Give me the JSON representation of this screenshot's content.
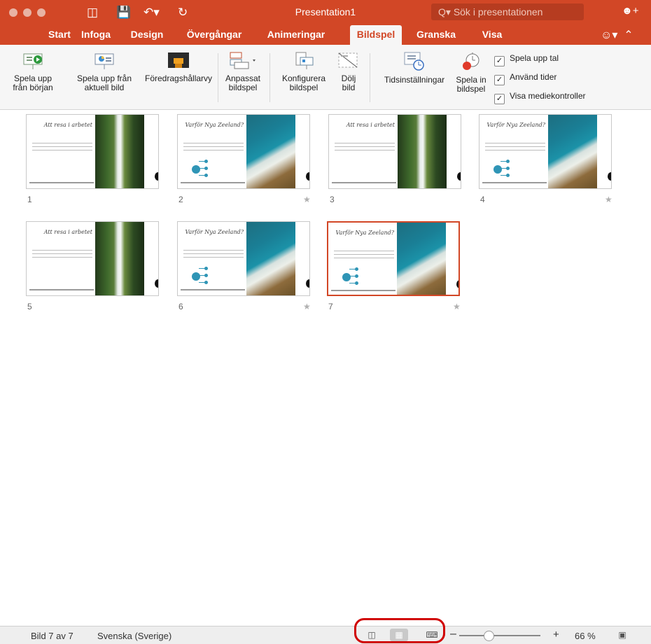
{
  "titlebar": {
    "title": "Presentation1",
    "search_placeholder": "Sök i presentationen"
  },
  "tabs": [
    "Start",
    "Infoga",
    "Design",
    "Övergångar",
    "Animeringar",
    "Bildspel",
    "Granska",
    "Visa"
  ],
  "active_tab": "Bildspel",
  "ribbon": {
    "play_from_start": "Spela upp\nfrån början",
    "play_from_current": "Spela upp från\naktuell bild",
    "presenter_view": "Föredragshållarvy",
    "custom_show": "Anpassat\nbildspel",
    "configure_show": "Konfigurera\nbildspel",
    "hide_slide": "Dölj\nbild",
    "rehearse_timings": "Tidsinställningar",
    "record_show": "Spela in\nbildspel",
    "checkboxes": [
      {
        "label": "Spela upp tal",
        "checked": true
      },
      {
        "label": "Använd tider",
        "checked": true
      },
      {
        "label": "Visa mediekontroller",
        "checked": true
      }
    ]
  },
  "slides": [
    {
      "number": "1",
      "title": "Att resa i arbetet",
      "layout": "waterfall",
      "star": false,
      "selected": false
    },
    {
      "number": "2",
      "title": "Varför Nya Zeeland?",
      "layout": "sea",
      "star": true,
      "selected": false
    },
    {
      "number": "3",
      "title": "Att resa i arbetet",
      "layout": "waterfall",
      "star": false,
      "selected": false
    },
    {
      "number": "4",
      "title": "Varför Nya Zeeland?",
      "layout": "sea",
      "star": true,
      "selected": false
    },
    {
      "number": "5",
      "title": "Att resa i arbetet",
      "layout": "waterfall",
      "star": false,
      "selected": false
    },
    {
      "number": "6",
      "title": "Varför Nya Zeeland?",
      "layout": "sea",
      "star": true,
      "selected": false
    },
    {
      "number": "7",
      "title": "Varför Nya Zeeland?",
      "layout": "sea",
      "star": true,
      "selected": true
    }
  ],
  "status": {
    "slide_info": "Bild 7 av 7",
    "language": "Svenska (Sverige)",
    "zoom_minus": "–",
    "zoom_plus": "+",
    "zoom_level": "66 %",
    "zoom_fraction": 0.35
  },
  "colors": {
    "accent": "#d24726",
    "highlight_box": "#d00000"
  }
}
